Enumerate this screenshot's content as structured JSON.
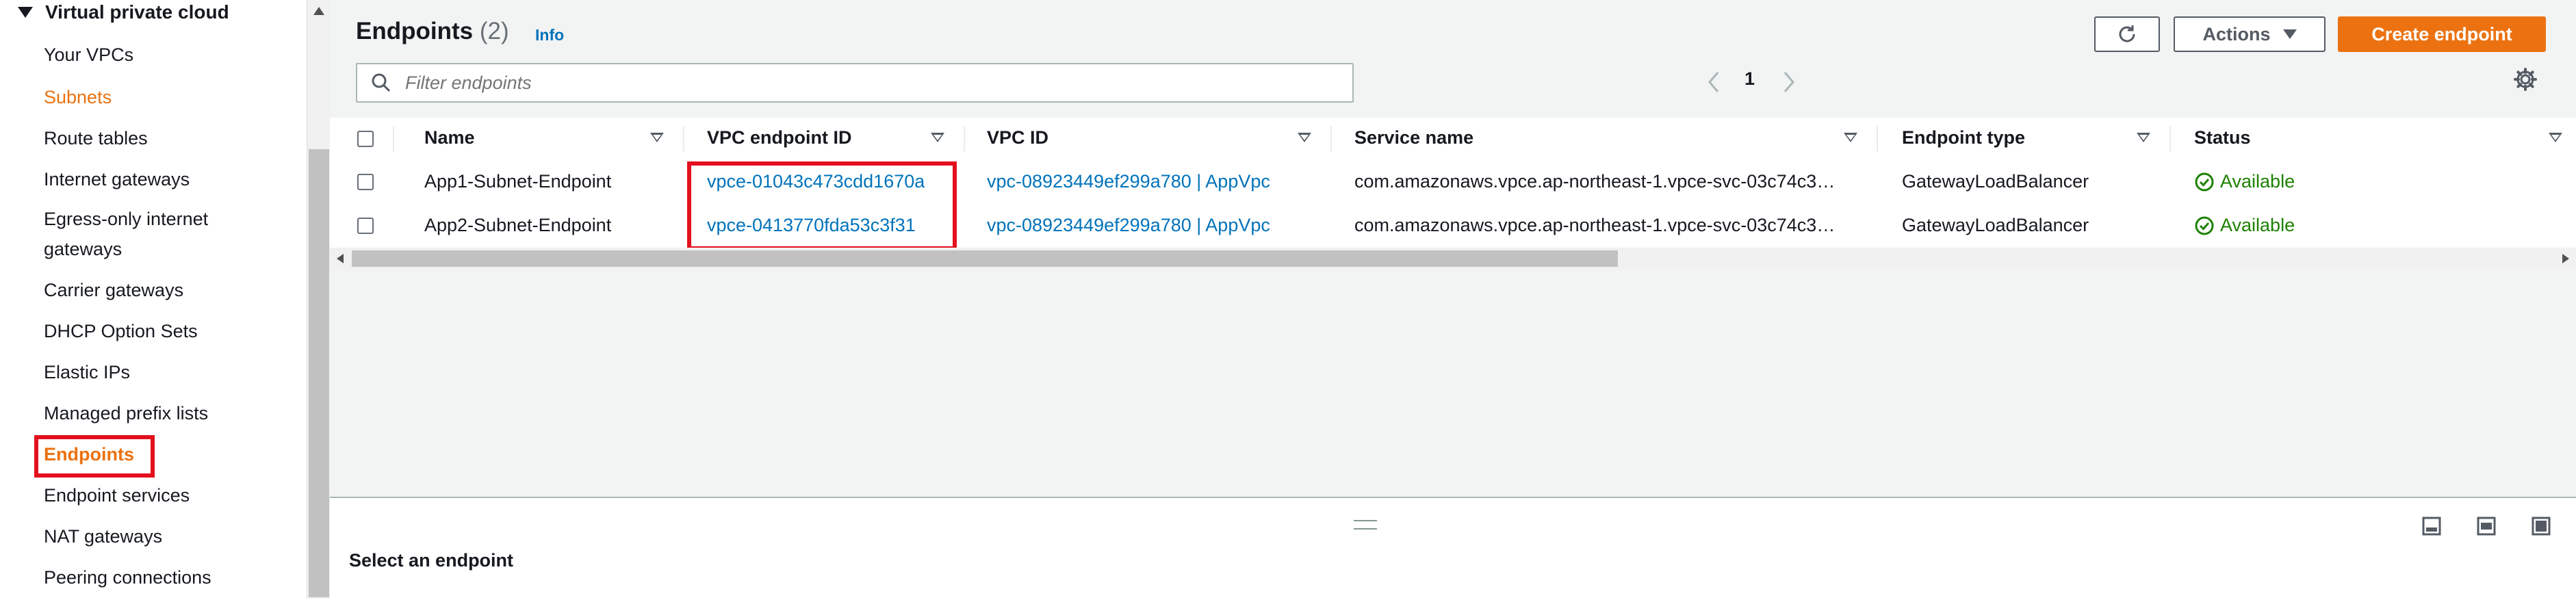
{
  "sidebar": {
    "section_title": "Virtual private cloud",
    "items": [
      {
        "label": "Your VPCs"
      },
      {
        "label": "Subnets"
      },
      {
        "label": "Route tables"
      },
      {
        "label": "Internet gateways"
      },
      {
        "label": "Egress-only internet"
      },
      {
        "label": "gateways"
      },
      {
        "label": "Carrier gateways"
      },
      {
        "label": "DHCP Option Sets"
      },
      {
        "label": "Elastic IPs"
      },
      {
        "label": "Managed prefix lists"
      },
      {
        "label": "Endpoints"
      },
      {
        "label": "Endpoint services"
      },
      {
        "label": "NAT gateways"
      },
      {
        "label": "Peering connections"
      }
    ]
  },
  "header": {
    "title": "Endpoints",
    "count": "(2)",
    "info": "Info",
    "actions_label": "Actions",
    "create_label": "Create endpoint"
  },
  "filter": {
    "placeholder": "Filter endpoints"
  },
  "pagination": {
    "current_page": "1"
  },
  "table": {
    "columns": [
      "Name",
      "VPC endpoint ID",
      "VPC ID",
      "Service name",
      "Endpoint type",
      "Status"
    ],
    "rows": [
      {
        "name": "App1-Subnet-Endpoint",
        "endpoint_id": "vpce-01043c473cdd1670a",
        "vpc_id": "vpc-08923449ef299a780 | AppVpc",
        "service_name": "com.amazonaws.vpce.ap-northeast-1.vpce-svc-03c74c3…",
        "endpoint_type": "GatewayLoadBalancer",
        "status": "Available"
      },
      {
        "name": "App2-Subnet-Endpoint",
        "endpoint_id": "vpce-0413770fda53c3f31",
        "vpc_id": "vpc-08923449ef299a780 | AppVpc",
        "service_name": "com.amazonaws.vpce.ap-northeast-1.vpce-svc-03c74c3…",
        "endpoint_type": "GatewayLoadBalancer",
        "status": "Available"
      }
    ]
  },
  "split_panel": {
    "title": "Select an endpoint"
  },
  "colors": {
    "accent_orange": "#ec7211",
    "link_blue": "#0073bb",
    "status_green": "#1d8102",
    "highlight_red": "#e3101e"
  }
}
